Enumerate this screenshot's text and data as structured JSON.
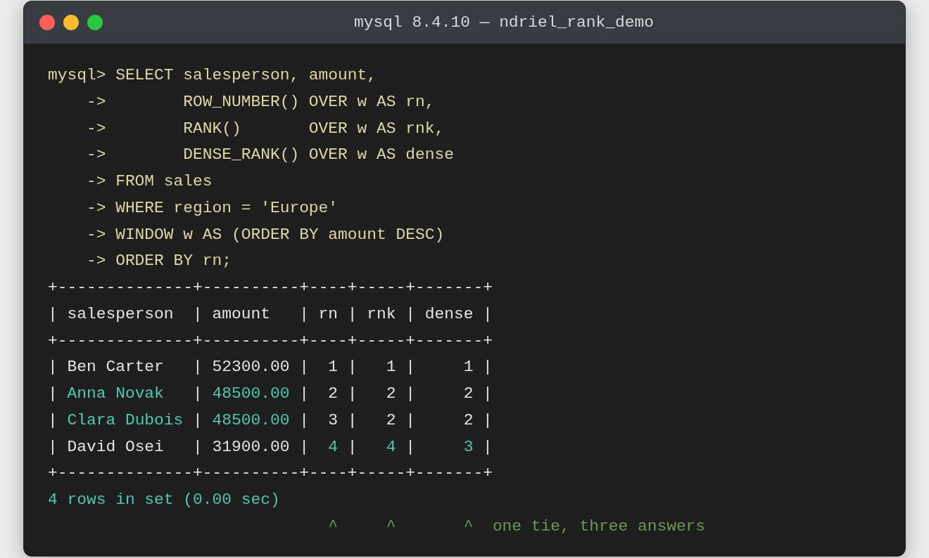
{
  "window": {
    "title": "mysql 8.4.10 — ndriel_rank_demo",
    "controls": [
      {
        "kind": "close"
      },
      {
        "kind": "minimize"
      },
      {
        "kind": "maximize"
      }
    ]
  },
  "query": [
    {
      "prompt": "mysql>",
      "code": "SELECT salesperson, amount,"
    },
    {
      "prompt": "->",
      "code": "       ROW_NUMBER() OVER w AS rn,"
    },
    {
      "prompt": "->",
      "code": "       RANK()       OVER w AS rnk,"
    },
    {
      "prompt": "->",
      "code": "       DENSE_RANK() OVER w AS dense"
    },
    {
      "prompt": "->",
      "code": "FROM sales"
    },
    {
      "prompt": "->",
      "code": "WHERE region = 'Europe'"
    },
    {
      "prompt": "->",
      "code": "WINDOW w AS (ORDER BY amount DESC)"
    },
    {
      "prompt": "->",
      "code": "ORDER BY rn;"
    }
  ],
  "result_table": {
    "lines": [
      {
        "kind": "border",
        "text": "+--------------+----------+----+-----+-------+"
      },
      {
        "kind": "header",
        "separators": [
          "|",
          "|",
          "|",
          "|",
          "|",
          "|"
        ],
        "cells": [
          "salesperson",
          "amount",
          "rn",
          "rnk",
          "dense"
        ]
      },
      {
        "kind": "border",
        "text": "+--------------+----------+----+-----+-------+"
      },
      {
        "kind": "row",
        "separators": [
          "|",
          "|",
          "|",
          "|",
          "|",
          "|"
        ],
        "cells": [
          {
            "kind": "text",
            "text": "Ben Carter",
            "accent": false
          },
          {
            "kind": "number",
            "text": "52300.00",
            "accent": false
          },
          {
            "kind": "number",
            "text": "1",
            "accent": false
          },
          {
            "kind": "number",
            "text": "1",
            "accent": false
          },
          {
            "kind": "number",
            "text": "1",
            "accent": false
          }
        ]
      },
      {
        "kind": "row",
        "separators": [
          "|",
          "|",
          "|",
          "|",
          "|",
          "|"
        ],
        "cells": [
          {
            "kind": "text",
            "text": "Anna Novak",
            "accent": true
          },
          {
            "kind": "number",
            "text": "48500.00",
            "accent": true
          },
          {
            "kind": "number",
            "text": "2",
            "accent": false
          },
          {
            "kind": "number",
            "text": "2",
            "accent": false
          },
          {
            "kind": "number",
            "text": "2",
            "accent": false
          }
        ]
      },
      {
        "kind": "row",
        "separators": [
          "|",
          "|",
          "|",
          "|",
          "|",
          "|"
        ],
        "cells": [
          {
            "kind": "text",
            "text": "Clara Dubois",
            "accent": true
          },
          {
            "kind": "number",
            "text": "48500.00",
            "accent": true
          },
          {
            "kind": "number",
            "text": "3",
            "accent": false
          },
          {
            "kind": "number",
            "text": "2",
            "accent": false
          },
          {
            "kind": "number",
            "text": "2",
            "accent": false
          }
        ]
      },
      {
        "kind": "row",
        "separators": [
          "|",
          "|",
          "|",
          "|",
          "|",
          "|"
        ],
        "cells": [
          {
            "kind": "text",
            "text": "David Osei",
            "accent": false
          },
          {
            "kind": "number",
            "text": "31900.00",
            "accent": false
          },
          {
            "kind": "number",
            "text": "4",
            "accent": true
          },
          {
            "kind": "number",
            "text": "4",
            "accent": true
          },
          {
            "kind": "number",
            "text": "3",
            "accent": true
          }
        ]
      },
      {
        "kind": "border",
        "text": "+--------------+----------+----+-----+-------+"
      }
    ]
  },
  "status": "4 rows in set (0.00 sec)",
  "note": "                             ^     ^       ^  one tie, three answers"
}
